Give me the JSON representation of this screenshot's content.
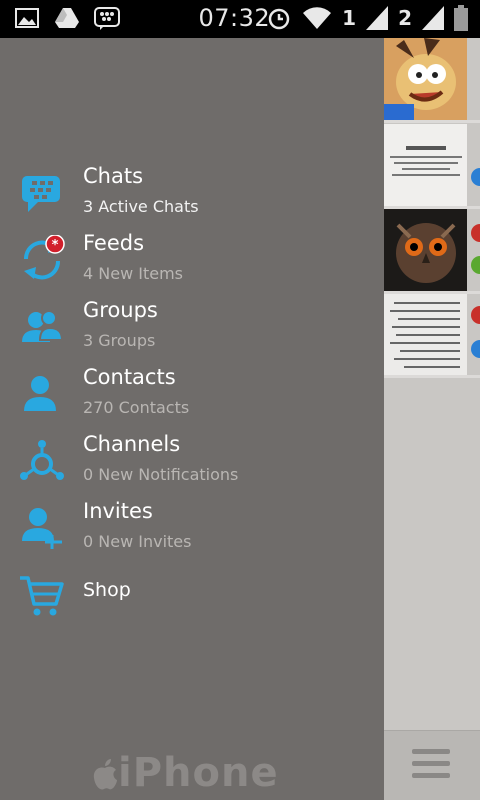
{
  "status_bar": {
    "time": "07:32",
    "sim1": "1",
    "sim2": "2",
    "icons": [
      "gallery-icon",
      "drive-icon",
      "bbm-icon",
      "alarm-icon",
      "wifi-icon",
      "signal-icon",
      "battery-icon"
    ]
  },
  "menu": {
    "items": [
      {
        "label": "Chats",
        "sub": "3 Active Chats",
        "icon": "chats-icon"
      },
      {
        "label": "Feeds",
        "sub": "4 New Items",
        "icon": "feeds-icon"
      },
      {
        "label": "Groups",
        "sub": "3 Groups",
        "icon": "groups-icon"
      },
      {
        "label": "Contacts",
        "sub": "270 Contacts",
        "icon": "contacts-icon"
      },
      {
        "label": "Channels",
        "sub": "0 New Notifications",
        "icon": "channels-icon"
      },
      {
        "label": "Invites",
        "sub": "0 New Invites",
        "icon": "invites-icon"
      },
      {
        "label": "Shop",
        "icon": "shop-icon"
      }
    ]
  },
  "watermark": {
    "text": "iPhone"
  },
  "colors": {
    "accent": "#29a8e0",
    "drawer_bg": "#6f6c6a",
    "alert_red": "#d21f2b"
  }
}
